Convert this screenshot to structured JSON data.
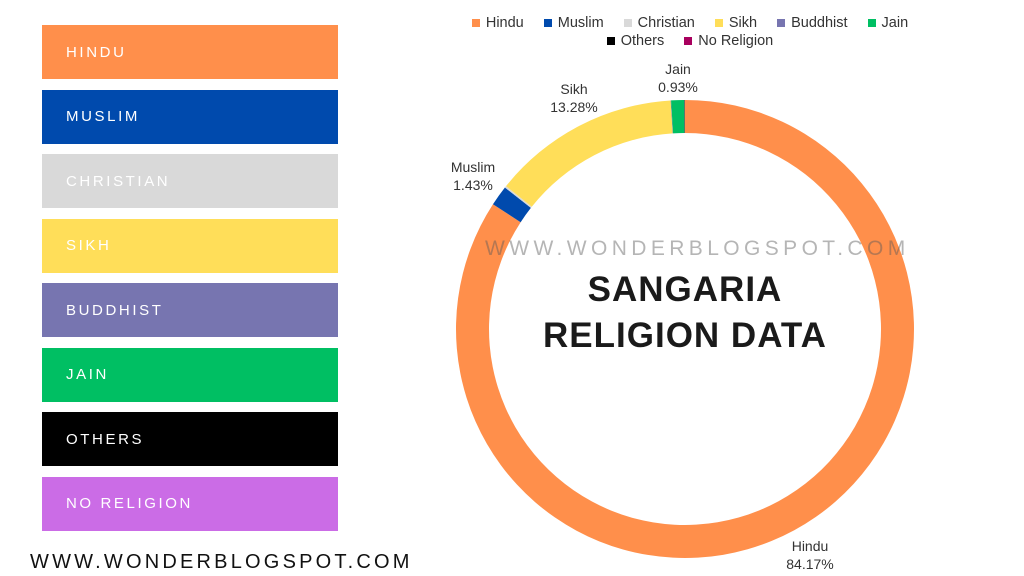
{
  "categories_panel": [
    {
      "label": "HINDU",
      "color": "#ff8f4b"
    },
    {
      "label": "MUSLIM",
      "color": "#004aad"
    },
    {
      "label": "CHRISTIAN",
      "color": "#d9d9d9"
    },
    {
      "label": "SIKH",
      "color": "#ffde59"
    },
    {
      "label": "BUDDHIST",
      "color": "#7775b0"
    },
    {
      "label": "JAIN",
      "color": "#00bf63"
    },
    {
      "label": "OTHERS",
      "color": "#000000"
    },
    {
      "label": "NO RELIGION",
      "color": "#cb6ce6"
    }
  ],
  "footer": {
    "website": "WWW.WONDERBLOGSPOT.COM"
  },
  "center": {
    "watermark": "WWW.WONDERBLOGSPOT.COM",
    "title_line1": "SANGARIA",
    "title_line2": "RELIGION DATA"
  },
  "chart_data": {
    "type": "pie",
    "variant": "donut",
    "title": "SANGARIA RELIGION DATA",
    "legend_position": "top",
    "start": "12 o'clock, clockwise",
    "series": [
      {
        "name": "Hindu",
        "value": 84.17,
        "label": "84.17%",
        "color": "#ff8f4b",
        "shown_label": true
      },
      {
        "name": "Muslim",
        "value": 1.43,
        "label": "1.43%",
        "color": "#004aad",
        "shown_label": true
      },
      {
        "name": "Christian",
        "value": 0.12,
        "label": "",
        "color": "#d9d9d9",
        "shown_label": false
      },
      {
        "name": "Sikh",
        "value": 13.28,
        "label": "13.28%",
        "color": "#ffde59",
        "shown_label": true
      },
      {
        "name": "Buddhist",
        "value": 0.03,
        "label": "",
        "color": "#7775b0",
        "shown_label": false
      },
      {
        "name": "Jain",
        "value": 0.93,
        "label": "0.93%",
        "color": "#00bf63",
        "shown_label": true
      },
      {
        "name": "Others",
        "value": 0.02,
        "label": "",
        "color": "#000000",
        "shown_label": false
      },
      {
        "name": "No Religion",
        "value": 0.02,
        "label": "",
        "color": "#a8005e",
        "shown_label": false
      }
    ],
    "legend_rows": [
      [
        "Hindu",
        "Muslim",
        "Christian",
        "Sikh",
        "Buddhist",
        "Jain"
      ],
      [
        "Others",
        "No Religion"
      ]
    ]
  }
}
